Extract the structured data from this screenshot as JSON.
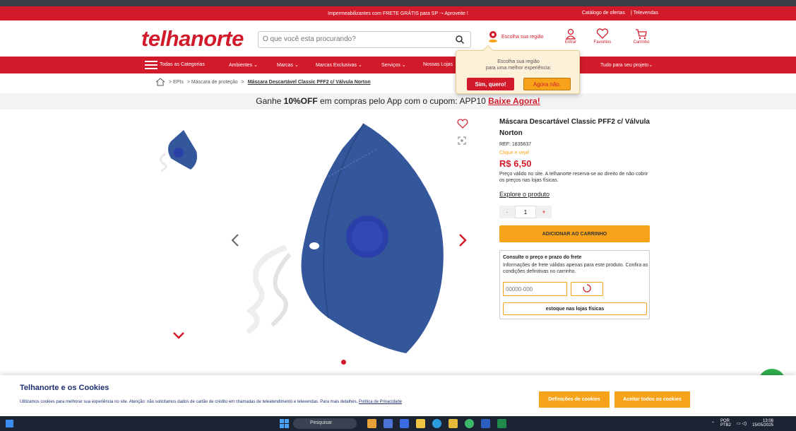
{
  "promo": {
    "text": "Impermeabilizantes com FRETE GRÁTIS para SP ⇾ Aproveite !",
    "catalog": "Catálogo de ofertas",
    "televendas": "| Televendas"
  },
  "header": {
    "logo_left": "telhanorte",
    "search_placeholder": "O que você esta procurando?",
    "region_label": "Escolha sua região",
    "login_label": "Entrar",
    "favorites_label": "Favoritos",
    "cart_label": "Carrinho"
  },
  "nav": {
    "items": [
      "Todas as Categorias",
      "Ambientes ⌄",
      "Marcas ⌄",
      "Marcas Exclusivas ⌄",
      "Serviços ⌄",
      "Nossas Lojas",
      "Tudo para seu projeto⌄"
    ]
  },
  "region_popup": {
    "line1": "Escolha sua região",
    "line2": "para uma melhor experiência:",
    "yes": "Sim, quero!",
    "no": "Agora não."
  },
  "breadcrumb": {
    "items": [
      "> EPIs",
      "> Máscara de proteção",
      ">",
      "Máscara Descartável Classic PFF2 c/ Válvula Norton"
    ]
  },
  "app_banner": {
    "prefix": "Ganhe ",
    "highlight": "10%OFF",
    "middle": " em compras pelo App com o cupom: APP10 ",
    "link": "Baixe Agora!"
  },
  "product": {
    "title": "Máscara Descartável Classic PFF2 c/ Válvula Norton",
    "ref": "REF: 1835637",
    "clique": "Clique e veja!",
    "price": "R$ 6,50",
    "price_note": "Preço válido no site. A telhanorte reserva-se ao direito de não cobrir os preços nas lojas físicas.",
    "explore": "Explore o produto",
    "qty_minus": "-",
    "qty_value": "1",
    "qty_plus": "+",
    "add_to_cart": "ADICIONAR AO CARRINHO",
    "image_colors": {
      "mask": "#34579c",
      "valve": "#2b3fa8"
    }
  },
  "shipping": {
    "title": "Consulte o preço e prazo do frete",
    "desc": "Informações de frete válidas apenas para este produto. Confira as condições definitivas no carrinho.",
    "cep_placeholder": "00000-000",
    "stock_button": "estoque nas lojas físicas"
  },
  "cookies": {
    "title": "Telhanorte e os Cookies",
    "text": "Utilizamos cookies para melhorar sua experiência no site. Atenção: não solicitamos dados de cartão de crédito em chamadas de teleatendimento e televendas. Para mais detalhes,",
    "policy_link": "Política de Privacidade",
    "settings_button": "Definições de cookies",
    "accept_button": "Aceitar todos os cookies"
  },
  "taskbar": {
    "search": "Pesquisar",
    "lang": "POR",
    "layout": "PTB2",
    "time": "13:08",
    "date": "15/05/2025"
  },
  "colors": {
    "brand_red": "#d21a2b",
    "brand_orange": "#f6a31a"
  }
}
